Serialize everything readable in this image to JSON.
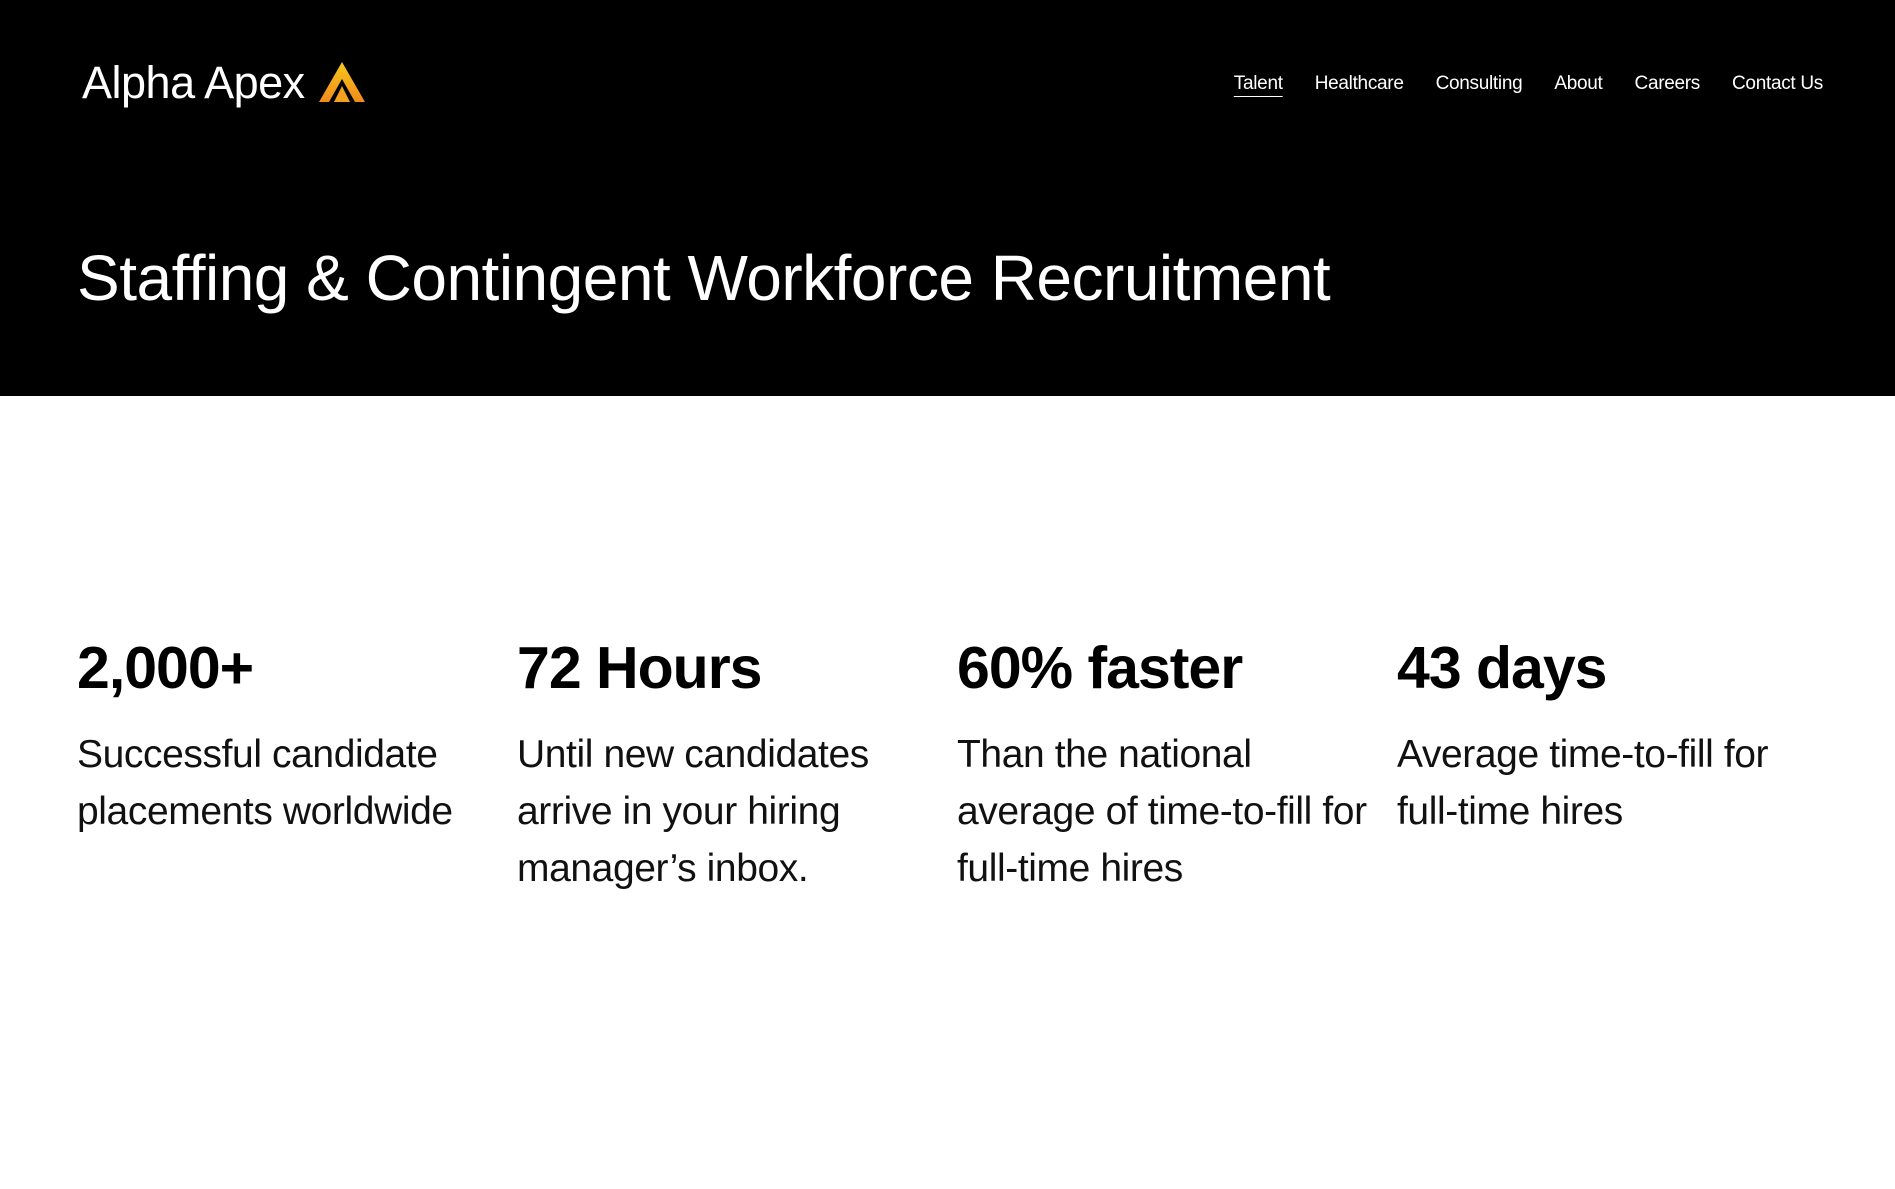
{
  "header": {
    "logo_text": "Alpha Apex",
    "logo_icon": "chevron-a-logo-icon",
    "nav": [
      {
        "label": "Talent",
        "active": true
      },
      {
        "label": "Healthcare",
        "active": false
      },
      {
        "label": "Consulting",
        "active": false
      },
      {
        "label": "About",
        "active": false
      },
      {
        "label": "Careers",
        "active": false
      },
      {
        "label": "Contact Us",
        "active": false
      }
    ]
  },
  "hero": {
    "title": "Staffing & Contingent Workforce Recruitment"
  },
  "stats": [
    {
      "value": "2,000+",
      "description": "Successful candidate placements worldwide"
    },
    {
      "value": "72 Hours",
      "description": "Until new candidates arrive in your hiring manager’s inbox."
    },
    {
      "value": "60% faster",
      "description": "Than the national average of time-to-fill for full-time hires"
    },
    {
      "value": "43 days",
      "description": "Average time-to-fill for full-time hires"
    }
  ],
  "colors": {
    "hero_background": "#000000",
    "logo_accent_top": "#f5c518",
    "logo_accent_bottom": "#f08a1c",
    "text_on_dark": "#ffffff",
    "text_on_light": "#000000"
  }
}
